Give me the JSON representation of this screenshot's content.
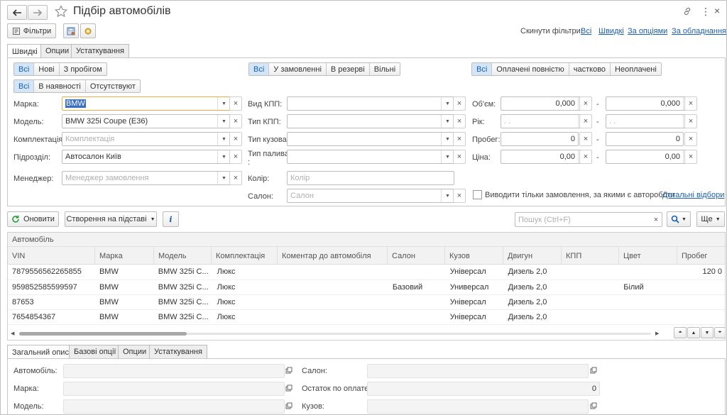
{
  "window": {
    "title": "Підбір автомобілів"
  },
  "toolbar": {
    "filters_label": "Фільтри"
  },
  "reset": {
    "label": "Скинути фільтри:",
    "links": [
      "Всі",
      "Швидкі",
      "За опціями",
      "За обладнанням"
    ]
  },
  "tabs_top": [
    "Швидкі",
    "Опции",
    "Устаткування"
  ],
  "segments": {
    "mileage": [
      "Всі",
      "Нові",
      "З пробігом"
    ],
    "order": [
      "Всі",
      "У замовленні",
      "В резерві",
      "Вільні"
    ],
    "payment": [
      "Всі",
      "Оплачені повністю",
      "частково",
      "Неоплачені"
    ],
    "availability": [
      "Всі",
      "В наявності",
      "Отсутствуют"
    ]
  },
  "form": {
    "brand": {
      "label": "Марка:",
      "value": "BMW"
    },
    "model": {
      "label": "Модель:",
      "value": "BMW 325i Coupe (E36)"
    },
    "equipment": {
      "label": "Комплектація:",
      "placeholder": "Комплектація"
    },
    "division": {
      "label": "Підрозділ:",
      "value": "Автосалон Київ"
    },
    "manager": {
      "label": "Менеджер:",
      "placeholder": "Менеджер замовлення"
    },
    "gearbox_kind": {
      "label": "Вид КПП:"
    },
    "gearbox_type": {
      "label": "Тип КПП:"
    },
    "body_type": {
      "label": "Тип кузова:"
    },
    "fuel_type": {
      "label": "Тип палива",
      "label_tail": ":"
    },
    "color": {
      "label": "Колір:",
      "placeholder": "Колір"
    },
    "salon": {
      "label": "Салон:",
      "placeholder": "Салон"
    },
    "volume": {
      "label": "Об'єм:",
      "from": "0,000",
      "to": "0,000"
    },
    "year": {
      "label": "Рік:",
      "from": ". .",
      "to": ". ."
    },
    "mileage": {
      "label": "Пробег:",
      "from": "0",
      "to": "0"
    },
    "price": {
      "label": "Ціна:",
      "from": "0,00",
      "to": "0,00"
    },
    "range_dash": "-",
    "checkbox_label": "Виводити тільки замовлення, за якими є автороботи",
    "details_link": "Детальні відбори"
  },
  "actions": {
    "refresh": "Оновити",
    "create_based": "Створення на підставі",
    "search_placeholder": "Пошук (Ctrl+F)",
    "more": "Ще"
  },
  "grid": {
    "group_header": "Автомобіль",
    "columns": [
      "VIN",
      "Марка",
      "Модель",
      "Комплектація",
      "Коментар до автомобіля",
      "Салон",
      "Кузов",
      "Двигун",
      "КПП",
      "Цвет",
      "Пробег"
    ],
    "rows": [
      [
        "7879556562265855",
        "BMW",
        "BMW 325i C...",
        "Люкс",
        "",
        "",
        "Універсал",
        "Дизель 2,0",
        "",
        "",
        "120 0"
      ],
      [
        "959852585599597",
        "BMW",
        "BMW 325i C...",
        "Люкс",
        "",
        "Базовий",
        "Универсал",
        "Дизель 2,0",
        "",
        "Білий",
        ""
      ],
      [
        "87653",
        "BMW",
        "BMW 325i C...",
        "Люкс",
        "",
        "",
        "Універсал",
        "Дизель 2,0",
        "",
        "",
        ""
      ],
      [
        "7654854367",
        "BMW",
        "BMW 325i C...",
        "Люкс",
        "",
        "",
        "Універсал",
        "Дизель 2,0",
        "",
        "",
        ""
      ]
    ]
  },
  "tabs_bottom": [
    "Загальний опис",
    "Базові опції",
    "Опции",
    "Устаткування"
  ],
  "details": {
    "car": "Автомобіль:",
    "brand": "Марка:",
    "model": "Модель:",
    "salon": "Салон:",
    "balance": {
      "label": "Остаток по оплате:",
      "value": "0"
    },
    "body": "Кузов:"
  },
  "colors": {
    "accent": "#1a5fb4",
    "active_segment": "#d3e5f7",
    "selection": "#3a6fc4"
  }
}
